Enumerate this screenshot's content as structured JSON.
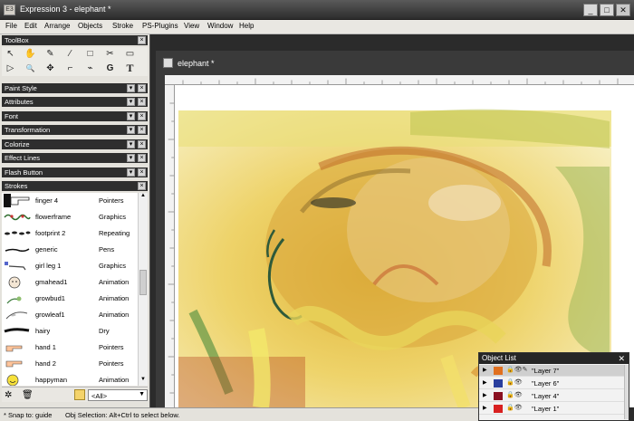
{
  "window": {
    "title": "Expression 3 - elephant *",
    "icon_label": "E3"
  },
  "window_buttons": {
    "minimize": "_",
    "maximize": "□",
    "close": "✕"
  },
  "menu": [
    "File",
    "Edit",
    "Arrange",
    "Objects",
    "Stroke",
    "PS-Plugins",
    "View",
    "Window",
    "Help"
  ],
  "panels": {
    "toolbox": "ToolBox",
    "collapsed": [
      "Paint Style",
      "Attributes",
      "Font",
      "Transformation",
      "Colorize",
      "Effect Lines",
      "Flash Button"
    ],
    "strokes": "Strokes"
  },
  "tools": {
    "row1": [
      "arrow-icon",
      "hand-icon",
      "brush-icon",
      "eyedropper-icon",
      "rectangle-icon",
      "scissors-icon",
      "marquee-icon"
    ],
    "row2": [
      "node-arrow-icon",
      "zoom-icon",
      "star-move-icon",
      "knife-icon",
      "pen-node-icon",
      "spiral-G-icon",
      "text-T-icon"
    ],
    "row1_glyphs": [
      "↖",
      "✋",
      "✎",
      "⁄",
      "□",
      "✂",
      "▭"
    ],
    "row2_glyphs": [
      "▷",
      "🔍",
      "✥",
      "⌐",
      "⌁",
      "G",
      "T"
    ]
  },
  "strokes": [
    {
      "name": "finger 4",
      "type": "Pointers"
    },
    {
      "name": "flowerframe",
      "type": "Graphics"
    },
    {
      "name": "footprint 2",
      "type": "Repeating"
    },
    {
      "name": "generic",
      "type": "Pens"
    },
    {
      "name": "girl leg 1",
      "type": "Graphics"
    },
    {
      "name": "gmahead1",
      "type": "Animation"
    },
    {
      "name": "growbud1",
      "type": "Animation"
    },
    {
      "name": "growleaf1",
      "type": "Animation"
    },
    {
      "name": "hairy",
      "type": "Dry"
    },
    {
      "name": "hand 1",
      "type": "Pointers"
    },
    {
      "name": "hand 2",
      "type": "Pointers"
    },
    {
      "name": "happyman",
      "type": "Animation"
    }
  ],
  "strokes_filter": "<All>",
  "document": {
    "title": "elephant *"
  },
  "object_list": {
    "title": "Object List",
    "layers": [
      {
        "name": "\"Layer 7\"",
        "color": "#e07020"
      },
      {
        "name": "\"Layer 6\"",
        "color": "#2a3f9e"
      },
      {
        "name": "\"Layer 4\"",
        "color": "#8a1020"
      },
      {
        "name": "\"Layer 1\"",
        "color": "#d82020"
      }
    ]
  },
  "status": {
    "snap": "* Snap to: guide",
    "hint": "Obj Selection: Alt+Ctrl to select below."
  }
}
